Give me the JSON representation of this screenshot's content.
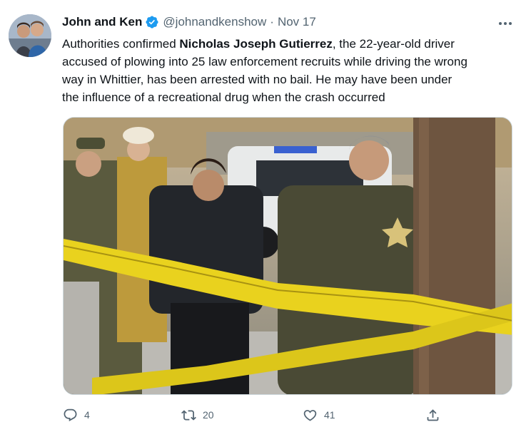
{
  "tweet": {
    "author": {
      "display_name": "John and Ken",
      "handle": "@johnandkenshow",
      "date": "Nov 17",
      "verified": true,
      "verified_color": "#1d9bf0"
    },
    "text": {
      "line1_pre": "Authorities confirmed ",
      "line1_bold": "Nicholas Joseph Gutierrez",
      "line1_post": ", the 22-year-old driver",
      "line2": "accused of plowing into 25 law enforcement recruits while driving the wrong",
      "line3": "way in Whittier, has been arrested with no bail. He may have been under",
      "line4": "the influence of a recreational drug when the crash occurred"
    },
    "actions": {
      "reply_count": "4",
      "retweet_count": "20",
      "like_count": "41"
    },
    "icons": {
      "more": "more-icon",
      "reply": "reply-icon",
      "retweet": "retweet-icon",
      "like": "heart-icon",
      "share": "share-icon"
    }
  }
}
